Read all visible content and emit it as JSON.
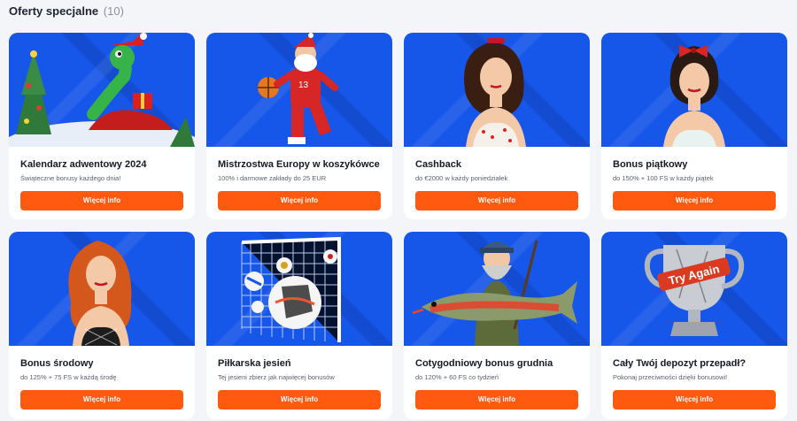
{
  "header": {
    "title": "Oferty specjalne",
    "count": "(10)"
  },
  "offers": [
    {
      "title": "Kalendarz adwentowy 2024",
      "subtitle": "Świąteczne bonusy każdego dnia!",
      "button": "Więcej info",
      "image": "christmas-snake-icon"
    },
    {
      "title": "Mistrzostwa Europy w koszykówce",
      "subtitle": "100% i darmowe zakłady do 25 EUR",
      "button": "Więcej info",
      "image": "santa-basketball-icon"
    },
    {
      "title": "Cashback",
      "subtitle": "do €2000 w każdy poniedziałek",
      "button": "Więcej info",
      "image": "pinup-girl-icon"
    },
    {
      "title": "Bonus piątkowy",
      "subtitle": "do 150% + 100 FS w każdy piątek",
      "button": "Więcej info",
      "image": "pinup-girl-bow-icon"
    },
    {
      "title": "Bonus środowy",
      "subtitle": "do 125% + 75 FS w każdą środę",
      "button": "Więcej info",
      "image": "redhead-girl-icon"
    },
    {
      "title": "Piłkarska jesień",
      "subtitle": "Tej jesieni zbierz jak najwięcej bonusów",
      "button": "Więcej info",
      "image": "football-goal-icon"
    },
    {
      "title": "Cotygodniowy bonus grudnia",
      "subtitle": "do 120% + 60 FS co tydzień",
      "button": "Więcej info",
      "image": "fisherman-fish-icon"
    },
    {
      "title": "Cały Twój depozyt przepadł?",
      "subtitle": "Pokonaj przeciwności dzięki bonusowi!",
      "button": "Więcej info",
      "image": "trophy-icon",
      "badge": "Try Again"
    }
  ],
  "colors": {
    "card_art_bg": "#1656e8",
    "button_bg": "#ff5a10"
  }
}
